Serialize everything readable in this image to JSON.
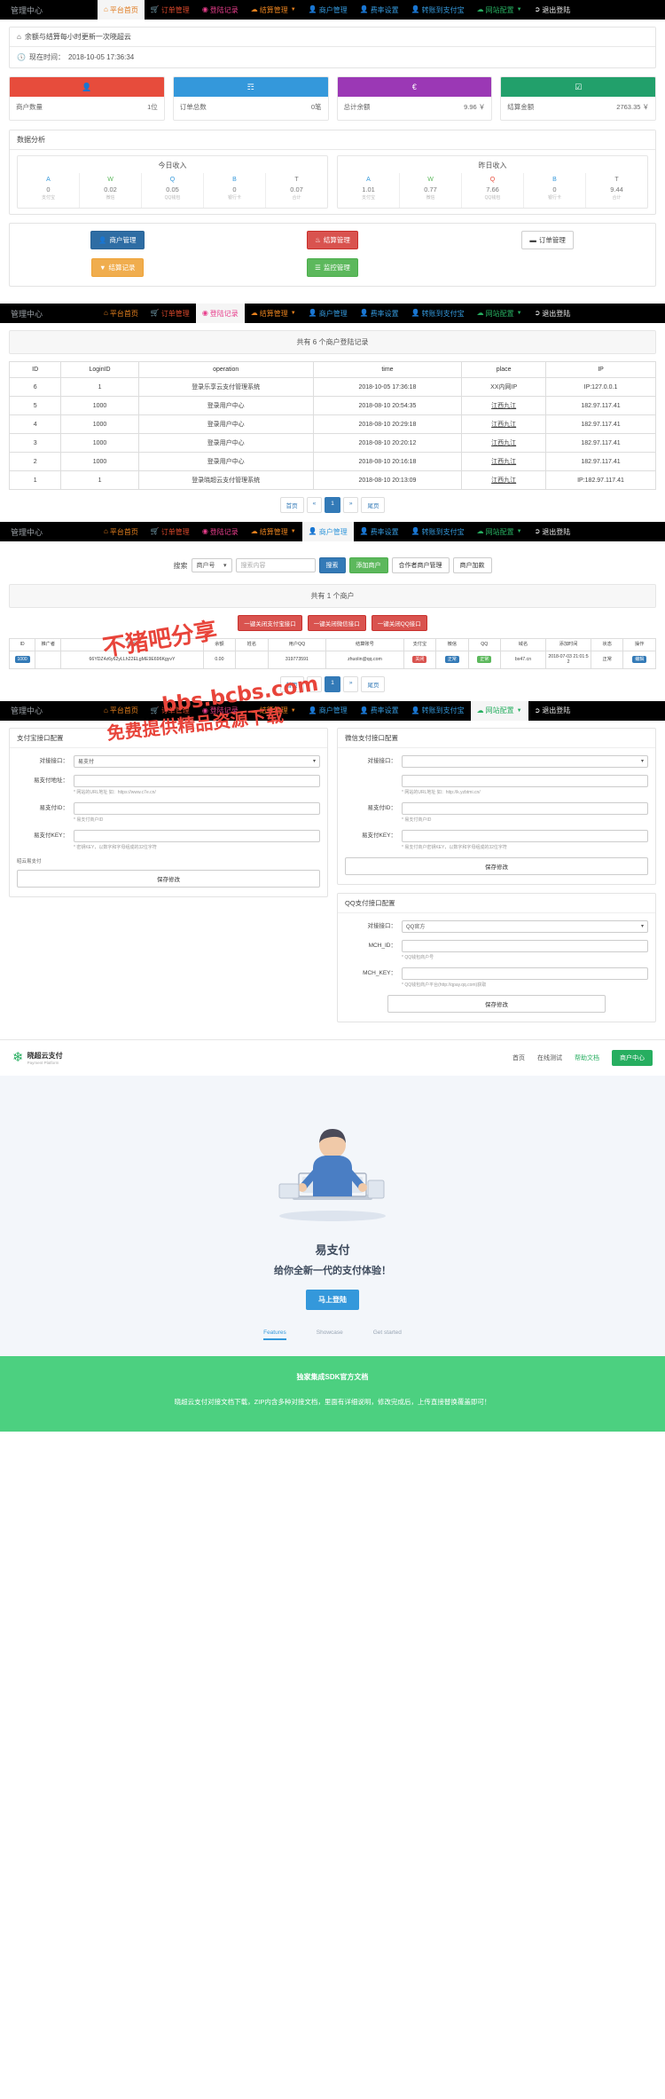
{
  "nav": {
    "brand": "管理中心",
    "items": [
      {
        "label": "平台首页",
        "icon": "home-icon",
        "color": "c-orange",
        "active": true
      },
      {
        "label": "订单管理",
        "icon": "cart-icon",
        "color": "c-red",
        "active": false
      },
      {
        "label": "登陆记录",
        "icon": "camera-icon",
        "color": "c-pink",
        "active": false
      },
      {
        "label": "结算管理",
        "icon": "cloud-icon",
        "color": "c-orange",
        "active": false,
        "caret": true
      },
      {
        "label": "商户管理",
        "icon": "user-icon",
        "color": "c-blue",
        "active": false
      },
      {
        "label": "费率设置",
        "icon": "user-icon",
        "color": "c-blue",
        "active": false
      },
      {
        "label": "转账到支付宝",
        "icon": "user-icon",
        "color": "c-blue",
        "active": false
      },
      {
        "label": "网站配置",
        "icon": "cloud-icon",
        "color": "c-green",
        "active": false,
        "caret": true
      },
      {
        "label": "退出登陆",
        "icon": "logout-icon",
        "color": "c-white",
        "active": false
      }
    ]
  },
  "dashboard": {
    "notice": "余额与结算每小时更新一次晓超云",
    "time_label": "现在时间：",
    "time_value": "2018-10-05 17:36:34",
    "tiles": [
      {
        "icon": "user-icon",
        "color": "#e74c3c",
        "label": "商户数量",
        "value": "1位"
      },
      {
        "icon": "list-icon",
        "color": "#3498db",
        "label": "订单总数",
        "value": "0笔"
      },
      {
        "icon": "euro-icon",
        "color": "#9b38b5",
        "label": "总计余额",
        "value": "9.96 ￥"
      },
      {
        "icon": "check-square-icon",
        "color": "#22a06b",
        "label": "结算金额",
        "value": "2763.35 ￥"
      }
    ],
    "analysis_title": "数据分析",
    "income_cards": [
      {
        "title": "今日收入",
        "cells": [
          {
            "icon": "A",
            "icon_color": "#3498db",
            "value": "0",
            "caption": "支付宝"
          },
          {
            "icon": "W",
            "icon_color": "#5cb85c",
            "value": "0.02",
            "caption": "微信"
          },
          {
            "icon": "Q",
            "icon_color": "#3498db",
            "value": "0.05",
            "caption": "QQ钱包"
          },
          {
            "icon": "B",
            "icon_color": "#3498db",
            "value": "0",
            "caption": "银行卡"
          },
          {
            "icon": "T",
            "icon_color": "#777777",
            "value": "0.07",
            "caption": "合计"
          }
        ]
      },
      {
        "title": "昨日收入",
        "cells": [
          {
            "icon": "A",
            "icon_color": "#3498db",
            "value": "1.01",
            "caption": "支付宝"
          },
          {
            "icon": "W",
            "icon_color": "#5cb85c",
            "value": "0.77",
            "caption": "微信"
          },
          {
            "icon": "Q",
            "icon_color": "#e74c3c",
            "value": "7.66",
            "caption": "QQ钱包"
          },
          {
            "icon": "B",
            "icon_color": "#3498db",
            "value": "0",
            "caption": "银行卡"
          },
          {
            "icon": "T",
            "icon_color": "#777777",
            "value": "9.44",
            "caption": "合计"
          }
        ]
      }
    ],
    "quick_buttons": [
      [
        {
          "label": "商户管理",
          "style": "btn-blue",
          "icon": "user-icon"
        },
        {
          "label": "结算记录",
          "style": "btn-orange",
          "icon": "filter-icon"
        }
      ],
      [
        {
          "label": "结算管理",
          "style": "btn-red",
          "icon": "fire-icon"
        },
        {
          "label": "监控管理",
          "style": "btn-green",
          "icon": "bars-icon"
        }
      ],
      [
        {
          "label": "订单管理",
          "style": "btn-white",
          "icon": "minus-icon"
        }
      ]
    ]
  },
  "login_records": {
    "count_text": "共有 6 个商户登陆记录",
    "columns": [
      "ID",
      "LoginID",
      "operation",
      "time",
      "place",
      "IP"
    ],
    "rows": [
      [
        "6",
        "1",
        "登录乐享云支付管理系统",
        "2018-10-05 17:36:18",
        "XX内网IP",
        "IP:127.0.0.1"
      ],
      [
        "5",
        "1000",
        "登录用户中心",
        "2018-08-10 20:54:35",
        "江西九江",
        "182.97.117.41"
      ],
      [
        "4",
        "1000",
        "登录用户中心",
        "2018-08-10 20:29:18",
        "江西九江",
        "182.97.117.41"
      ],
      [
        "3",
        "1000",
        "登录用户中心",
        "2018-08-10 20:20:12",
        "江西九江",
        "182.97.117.41"
      ],
      [
        "2",
        "1000",
        "登录用户中心",
        "2018-08-10 20:16:18",
        "江西九江",
        "182.97.117.41"
      ],
      [
        "1",
        "1",
        "登录晓超云支付管理系统",
        "2018-08-10 20:13:09",
        "江西九江",
        "IP:182.97.117.41"
      ]
    ],
    "pager": [
      "首页",
      "«",
      "1",
      "»",
      "尾页"
    ],
    "pager_active": "1"
  },
  "merchants": {
    "search_label": "搜索",
    "search_select": "商户号",
    "search_placeholder": "搜索内容",
    "buttons": [
      {
        "label": "搜索",
        "style": "btn-primary"
      },
      {
        "label": "添加商户",
        "style": "btn-success"
      },
      {
        "label": "合作者商户管理",
        "style": "btn-default"
      },
      {
        "label": "商户加款",
        "style": "btn-default"
      }
    ],
    "count_text": "共有 1 个商户",
    "bulk_buttons": [
      {
        "label": "一键关闭支付宝接口",
        "style": "btn-red"
      },
      {
        "label": "一键关闭微信接口",
        "style": "btn-red"
      },
      {
        "label": "一键关闭QQ接口",
        "style": "btn-red"
      }
    ],
    "columns": [
      "ID",
      "推广者",
      "密钥",
      "余额",
      "姓名",
      "用户QQ",
      "结算账号",
      "支付宝",
      "微信",
      "QQ",
      "域名",
      "添加时间",
      "状态",
      "操作"
    ],
    "rows": [
      {
        "id": "1000",
        "promoter": "",
        "key": "66YDZ4z6y62yLLh22ELgME9E696KgyvY",
        "balance": "0.00",
        "name": "",
        "qq": "319773591",
        "settle_account": "zhuolin@qq.com",
        "alipay": "关闭",
        "wechat": "正常",
        "qqpay": "正常",
        "domain": "bx47.cn",
        "add_time": "2018-07-03 21:01:52",
        "status": "正常",
        "action": "编辑"
      }
    ],
    "pager": [
      "首页",
      "«",
      "1",
      "»",
      "尾页"
    ],
    "pager_active": "1"
  },
  "watermark": {
    "line1": "不猪吧分享",
    "line2": "bbs.bcbs.com",
    "line3": "免费提供精品资源下载"
  },
  "config": {
    "alipay": {
      "title": "支付宝接口配置",
      "fields": [
        {
          "label": "对接接口：",
          "type": "select",
          "value": "易支付",
          "hint": ""
        },
        {
          "label": "易支付地址：",
          "type": "input",
          "value": "",
          "hint": "* 网站的URL地址 如：https://www.c7e.cn/"
        },
        {
          "label": "易支付ID：",
          "type": "input",
          "value": "",
          "hint": "* 易支付商户ID"
        },
        {
          "label": "易支付KEY：",
          "type": "input",
          "value": "",
          "hint": "* 密钥KEY，以数字和字母组成的32位字符"
        }
      ],
      "footer_link": "昭云易支付",
      "submit": "保存修改"
    },
    "wechat": {
      "title": "微信支付接口配置",
      "fields": [
        {
          "label": "对接接口：",
          "type": "select",
          "value": "",
          "hint": ""
        },
        {
          "label": "",
          "type": "hint-only",
          "value": "",
          "hint": "* 网站的URL地址 如：http://k.yzbtmi.cn/"
        },
        {
          "label": "易支付ID：",
          "type": "input",
          "value": "",
          "hint": "* 易支付商户ID"
        },
        {
          "label": "易支付KEY：",
          "type": "input",
          "value": "",
          "hint": "* 易支付商户密钥KEY，以数字和字母组成的32位字符"
        }
      ],
      "submit": "保存修改"
    },
    "qq": {
      "title": "QQ支付接口配置",
      "fields": [
        {
          "label": "对接接口：",
          "type": "select",
          "value": "QQ官方",
          "hint": ""
        },
        {
          "label": "MCH_ID：",
          "type": "input",
          "value": "",
          "hint": "* QQ钱包商户号"
        },
        {
          "label": "MCH_KEY：",
          "type": "input",
          "value": "",
          "hint": "* QQ钱包商户平台(http://qpay.qq.com)获取"
        }
      ],
      "submit": "保存修改"
    }
  },
  "site": {
    "logo_title": "晓超云支付",
    "logo_sub": "Payment Platform",
    "nav": [
      "首页",
      "在线测试",
      "帮助文档"
    ],
    "nav_current": "帮助文档",
    "nav_button": "商户中心",
    "hero_title": "易支付",
    "hero_sub": "给你全新一代的支付体验！",
    "hero_cta": "马上登陆",
    "tabs": [
      {
        "label": "Features",
        "active": true
      },
      {
        "label": "Showcase",
        "active": false
      },
      {
        "label": "Get started",
        "active": false
      }
    ],
    "band_title": "独家集成SDK官方文档",
    "band_text": "晓超云支付对接文档下载，ZIP内含多种对接文档，里面有详细说明，修改完成后，上传直接替换覆盖即可！"
  }
}
